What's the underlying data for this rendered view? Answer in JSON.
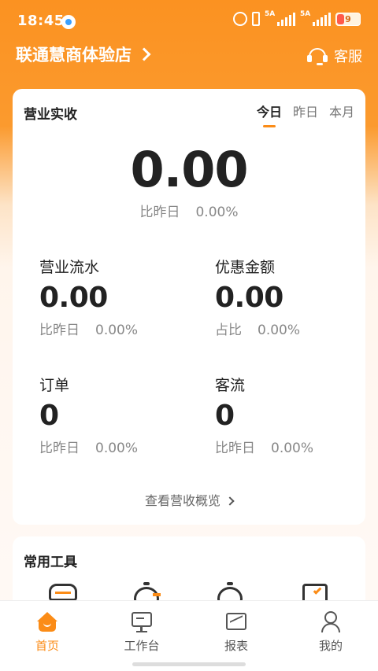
{
  "status_bar": {
    "time": "18:45",
    "net1": "5A",
    "net2": "5A",
    "battery": "9"
  },
  "header": {
    "store_name": "联通慧商体验店",
    "service_label": "客服"
  },
  "revenue": {
    "title": "营业实收",
    "tabs": [
      "今日",
      "昨日",
      "本月"
    ],
    "active_tab": "今日",
    "value": "0.00",
    "compare_label": "比昨日",
    "compare_value": "0.00%",
    "metrics": [
      {
        "label": "营业流水",
        "value": "0.00",
        "compare_label": "比昨日",
        "compare_value": "0.00%"
      },
      {
        "label": "优惠金额",
        "value": "0.00",
        "compare_label": "占比",
        "compare_value": "0.00%"
      },
      {
        "label": "订单",
        "value": "0",
        "compare_label": "比昨日",
        "compare_value": "0.00%"
      },
      {
        "label": "客流",
        "value": "0",
        "compare_label": "比昨日",
        "compare_value": "0.00%"
      }
    ],
    "overview_link": "查看营收概览"
  },
  "tools": {
    "title": "常用工具"
  },
  "bottom_nav": {
    "items": [
      {
        "label": "首页",
        "icon": "home-icon"
      },
      {
        "label": "工作台",
        "icon": "monitor-icon"
      },
      {
        "label": "报表",
        "icon": "chart-icon"
      },
      {
        "label": "我的",
        "icon": "user-icon"
      }
    ],
    "active": "首页"
  },
  "colors": {
    "accent": "#fb8c17",
    "header_bg": "#fb9221"
  }
}
